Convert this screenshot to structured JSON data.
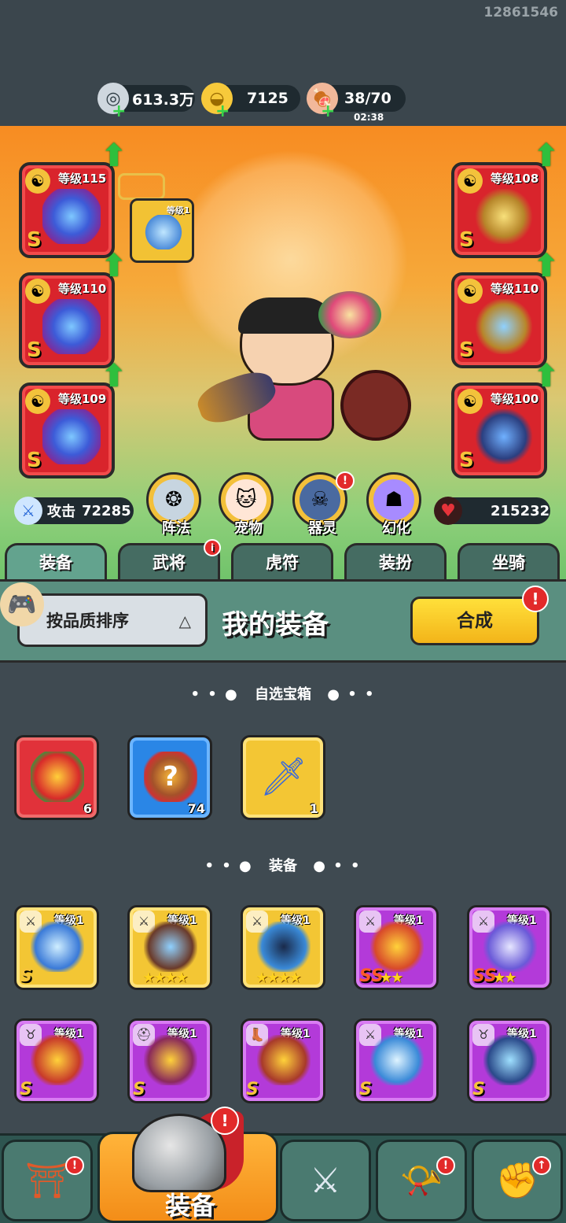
{
  "player_id": "12861546",
  "resources": {
    "coins": "613.3万",
    "gold": "7125",
    "stamina": "38/70",
    "stamina_timer": "02:38"
  },
  "equipped": {
    "left": [
      {
        "level_label": "等级115",
        "grade": "S"
      },
      {
        "level_label": "等级110",
        "grade": "S"
      },
      {
        "level_label": "等级109",
        "grade": "S"
      }
    ],
    "right": [
      {
        "level_label": "等级108",
        "grade": "S"
      },
      {
        "level_label": "等级110",
        "grade": "S"
      },
      {
        "level_label": "等级100",
        "grade": "S"
      }
    ],
    "mini_slot_level": "等级1"
  },
  "stats": {
    "attack_label": "攻击",
    "attack_value": "72285",
    "hp_value": "215232"
  },
  "round_buttons": [
    {
      "label": "阵法"
    },
    {
      "label": "宠物"
    },
    {
      "label": "器灵",
      "badge": "!"
    },
    {
      "label": "幻化"
    }
  ],
  "tabs": [
    {
      "label": "装备",
      "active": true
    },
    {
      "label": "武将",
      "badge": "i"
    },
    {
      "label": "虎符"
    },
    {
      "label": "装扮"
    },
    {
      "label": "坐骑"
    }
  ],
  "panel": {
    "sort_label": "按品质排序",
    "title": "我的装备",
    "synth_label": "合成",
    "synth_badge": "!"
  },
  "sections": {
    "chest_title": "自选宝箱",
    "equip_title": "装备"
  },
  "chests": [
    {
      "color": "red",
      "count": "6"
    },
    {
      "color": "blue",
      "count": "74"
    },
    {
      "color": "gold",
      "count": "1"
    }
  ],
  "equipment": [
    {
      "color": "gold",
      "level_label": "等级1",
      "grade": "S",
      "stars": ""
    },
    {
      "color": "gold",
      "level_label": "等级1",
      "grade": "",
      "stars": "★★★★"
    },
    {
      "color": "gold",
      "level_label": "等级1",
      "grade": "",
      "stars": "★★★★"
    },
    {
      "color": "purple",
      "level_label": "等级1",
      "grade": "SS",
      "stars": "★★"
    },
    {
      "color": "purple",
      "level_label": "等级1",
      "grade": "SS",
      "stars": "★★"
    },
    {
      "color": "purple",
      "level_label": "等级1",
      "grade": "S",
      "stars": ""
    },
    {
      "color": "purple",
      "level_label": "等级1",
      "grade": "S",
      "stars": ""
    },
    {
      "color": "purple",
      "level_label": "等级1",
      "grade": "S",
      "stars": ""
    },
    {
      "color": "purple",
      "level_label": "等级1",
      "grade": "S",
      "stars": ""
    },
    {
      "color": "purple",
      "level_label": "等级1",
      "grade": "S",
      "stars": ""
    }
  ],
  "bottom_nav": {
    "main_label": "装备",
    "main_badge": "!",
    "badges": [
      "!",
      "",
      "!",
      "↑"
    ]
  }
}
